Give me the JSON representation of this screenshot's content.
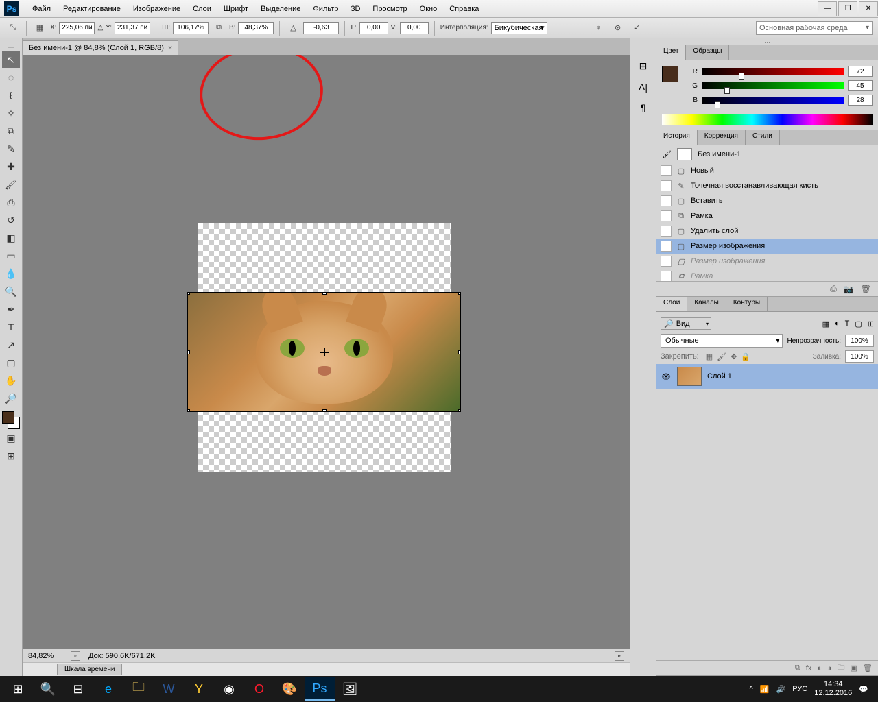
{
  "menu": {
    "items": [
      "Файл",
      "Редактирование",
      "Изображение",
      "Слои",
      "Шрифт",
      "Выделение",
      "Фильтр",
      "3D",
      "Просмотр",
      "Окно",
      "Справка"
    ]
  },
  "options": {
    "x_label": "X:",
    "x": "225,06 пи",
    "y_label": "Y:",
    "y": "231,37 пи",
    "w_label": "Ш:",
    "w": "106,17%",
    "h_label": "В:",
    "h": "48,37%",
    "angle": "-0,63",
    "hkos_label": "Г:",
    "hkos": "0,00",
    "vkos_label": "V:",
    "vkos": "0,00",
    "interp_label": "Интерполяция:",
    "interp": "Бикубическая",
    "workspace": "Основная рабочая среда"
  },
  "document": {
    "tab": "Без имени-1 @ 84,8% (Слой 1, RGB/8)",
    "zoom": "84,82%",
    "doc_size": "Док: 590,6K/671,2K"
  },
  "timeline": {
    "label": "Шкала времени"
  },
  "color": {
    "tab_color": "Цвет",
    "tab_swatch": "Образцы",
    "r": "R",
    "g": "G",
    "b": "B",
    "r_val": "72",
    "g_val": "45",
    "b_val": "28"
  },
  "history": {
    "tab_hist": "История",
    "tab_corr": "Коррекция",
    "tab_styles": "Стили",
    "doc_name": "Без имени-1",
    "items": [
      {
        "label": "Новый",
        "active": false
      },
      {
        "label": "Точечная восстанавливающая кисть",
        "active": false
      },
      {
        "label": "Вставить",
        "active": false
      },
      {
        "label": "Рамка",
        "active": false
      },
      {
        "label": "Удалить слой",
        "active": false
      },
      {
        "label": "Размер изображения",
        "active": true
      },
      {
        "label": "Размер изображения",
        "active": false,
        "future": true
      },
      {
        "label": "Рамка",
        "active": false,
        "future": true
      }
    ]
  },
  "layers": {
    "tab_layers": "Слои",
    "tab_channels": "Каналы",
    "tab_paths": "Контуры",
    "kind": "Вид",
    "blend": "Обычные",
    "opacity_label": "Непрозрачность:",
    "opacity": "100%",
    "lock_label": "Закрепить:",
    "fill_label": "Заливка:",
    "fill": "100%",
    "layer_name": "Слой 1"
  },
  "taskbar": {
    "time": "14:34",
    "date": "12.12.2016"
  }
}
